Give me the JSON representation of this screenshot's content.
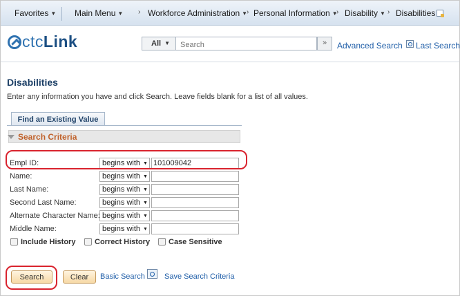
{
  "nav": {
    "favorites": "Favorites",
    "main_menu": "Main Menu",
    "crumbs": [
      "Workforce Administration",
      "Personal Information",
      "Disability",
      "Disabilities"
    ]
  },
  "header": {
    "logo_prefix": "ctc",
    "logo_suffix": "Link",
    "scope": "All",
    "search_placeholder": "Search",
    "advanced_search": "Advanced Search",
    "last_search": "Last Search"
  },
  "page": {
    "title": "Disabilities",
    "instructions": "Enter any information you have and click Search. Leave fields blank for a list of all values.",
    "tab": "Find an Existing Value",
    "criteria_label": "Search Criteria"
  },
  "fields": [
    {
      "label": "Empl ID:",
      "operator": "begins with",
      "value": "101009042"
    },
    {
      "label": "Name:",
      "operator": "begins with",
      "value": ""
    },
    {
      "label": "Last Name:",
      "operator": "begins with",
      "value": ""
    },
    {
      "label": "Second Last Name:",
      "operator": "begins with",
      "value": ""
    },
    {
      "label": "Alternate Character Name:",
      "operator": "begins with",
      "value": ""
    },
    {
      "label": "Middle Name:",
      "operator": "begins with",
      "value": ""
    }
  ],
  "checkboxes": {
    "include_history": "Include History",
    "correct_history": "Correct History",
    "case_sensitive": "Case Sensitive"
  },
  "actions": {
    "search": "Search",
    "clear": "Clear",
    "basic_search": "Basic Search",
    "save_criteria": "Save Search Criteria"
  },
  "colors": {
    "accent": "#1f5ea8",
    "criteria_text": "#c0622b",
    "highlight": "#d9232e"
  }
}
